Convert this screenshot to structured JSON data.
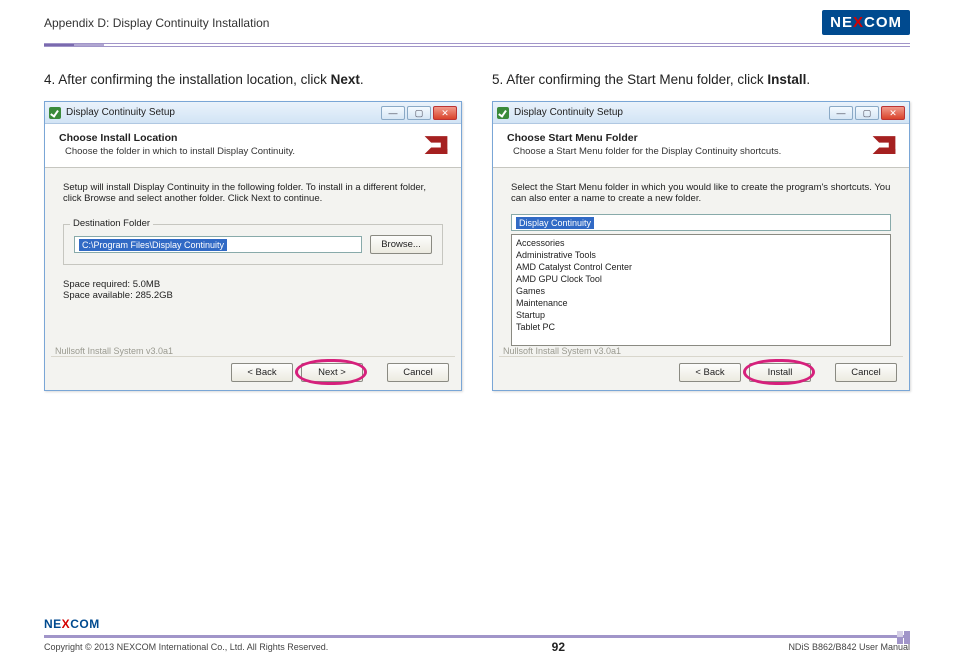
{
  "header": {
    "section_title": "Appendix D: Display Continuity Installation",
    "logo_pre": "NE",
    "logo_x": "X",
    "logo_post": "COM"
  },
  "left": {
    "num": "4.",
    "before": "After confirming the installation location, click ",
    "bold": "Next",
    "after": ".",
    "win": {
      "title": "Display Continuity Setup",
      "head_h1": "Choose Install Location",
      "head_h2": "Choose the folder in which to install Display Continuity.",
      "body_text": "Setup will install Display Continuity in the following folder. To install in a different folder, click Browse and select another folder. Click Next to continue.",
      "group_label": "Destination Folder",
      "dest_path": "C:\\Program Files\\Display Continuity",
      "browse": "Browse...",
      "space_req": "Space required: 5.0MB",
      "space_avail": "Space available: 285.2GB",
      "nsis": "Nullsoft Install System v3.0a1",
      "btn_back": "< Back",
      "btn_next": "Next >",
      "btn_cancel": "Cancel"
    }
  },
  "right": {
    "num": "5.",
    "before": "After confirming the Start Menu folder, click ",
    "bold": "Install",
    "after": ".",
    "win": {
      "title": "Display Continuity Setup",
      "head_h1": "Choose Start Menu Folder",
      "head_h2": "Choose a Start Menu folder for the Display Continuity shortcuts.",
      "body_text": "Select the Start Menu folder in which you would like to create the program's shortcuts. You can also enter a name to create a new folder.",
      "folder_value": "Display Continuity",
      "folders": [
        "Accessories",
        "Administrative Tools",
        "AMD Catalyst Control Center",
        "AMD GPU Clock Tool",
        "Games",
        "Maintenance",
        "Startup",
        "Tablet PC"
      ],
      "nsis": "Nullsoft Install System v3.0a1",
      "btn_back": "< Back",
      "btn_install": "Install",
      "btn_cancel": "Cancel"
    }
  },
  "footer": {
    "logo_pre": "NE",
    "logo_x": "X",
    "logo_post": "COM",
    "copyright": "Copyright © 2013 NEXCOM International Co., Ltd. All Rights Reserved.",
    "page_num": "92",
    "doc_ref": "NDiS B862/B842 User Manual"
  }
}
